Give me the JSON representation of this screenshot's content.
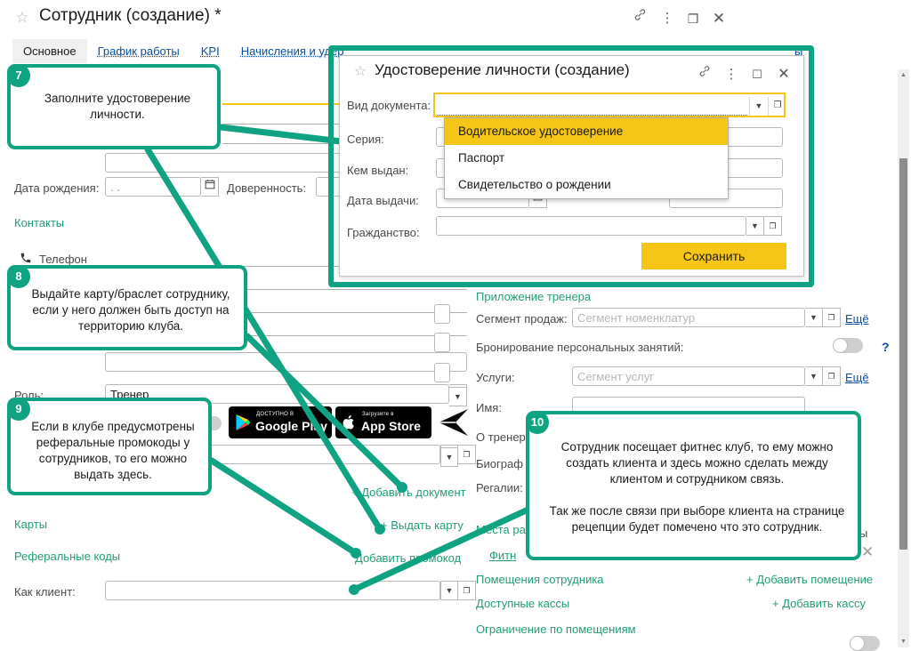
{
  "window": {
    "title": "Сотрудник (создание) *",
    "star_icon": "☆",
    "buttons": {
      "link": "link-icon",
      "menu": "menu-icon",
      "restore": "restore-icon",
      "close": "close-icon"
    }
  },
  "tabs": [
    {
      "label": "Основное",
      "active": true
    },
    {
      "label": "График работы",
      "active": false
    },
    {
      "label": "KPI",
      "active": false
    },
    {
      "label": "Начисления и удер",
      "active": false
    },
    {
      "label": "ы",
      "active": false
    }
  ],
  "form_left": {
    "birth_date": {
      "label": "Дата рождения:",
      "value": "  .    ."
    },
    "power_of_attorney": {
      "label": "Доверенность:"
    },
    "contacts_header": "Контакты",
    "phone": {
      "label": "Телефон",
      "icon": "phone-icon"
    },
    "role": {
      "label": "Роль:",
      "value": "Тренер"
    },
    "cards_header": "Карты",
    "referral_header": "Реферальные коды",
    "as_client": {
      "label": "Как клиент:",
      "value": ""
    },
    "badges": {
      "google_play": {
        "small": "ДОСТУПНО В",
        "big": "Google Play"
      },
      "app_store": {
        "small": "Загрузите в",
        "big": "App Store"
      },
      "telegram": "telegram-icon"
    }
  },
  "form_mid_links": {
    "add_document": "+ Добавить документ",
    "issue_card": "+ Выдать карту",
    "add_promocode": "Добавить промокод"
  },
  "form_right": {
    "trainer_app_header": "Приложение тренера",
    "sales_segment": {
      "label": "Сегмент продаж:",
      "placeholder": "Сегмент номенклатур",
      "more": "Ещё"
    },
    "personal_booking": {
      "label": "Бронирование персональных занятий:",
      "help": "?"
    },
    "services": {
      "label": "Услуги:",
      "placeholder": "Сегмент услуг",
      "more": "Ещё"
    },
    "name": {
      "label": "Имя:"
    },
    "about_trainer": {
      "label": "О тренер"
    },
    "biography": {
      "label": "Биограф"
    },
    "regalia": {
      "label": "Регалии:"
    },
    "workplaces": {
      "label": "Места ра"
    },
    "fitness_link": "Фитн",
    "truncated_link": "ра:",
    "truncated_text": "ты",
    "rooms": {
      "label": "Помещения сотрудника",
      "action": "+ Добавить помещение"
    },
    "cashboxes": {
      "label": "Доступные кассы",
      "action": "+ Добавить кассу"
    },
    "room_restriction": {
      "label": "Ограничение по помещениям"
    }
  },
  "modal": {
    "star_icon": "☆",
    "title": "Удостоверение личности (создание)",
    "buttons": {
      "link": "link-icon",
      "menu": "menu-icon",
      "restore": "restore-icon",
      "close": "close-icon"
    },
    "fields": {
      "doc_type": {
        "label": "Вид документа:",
        "value": ""
      },
      "series": {
        "label": "Серия:"
      },
      "issued_by": {
        "label": "Кем выдан:"
      },
      "issue_date": {
        "label": "Дата выдачи:"
      },
      "citizenship": {
        "label": "Гражданство:"
      }
    },
    "dropdown_options": [
      {
        "label": "Водительское удостоверение",
        "selected": true
      },
      {
        "label": "Паспорт",
        "selected": false
      },
      {
        "label": "Свидетельство о рождении",
        "selected": false
      }
    ],
    "save_button": "Сохранить"
  },
  "callouts": [
    {
      "number": "7",
      "text": "Заполните удостоверение личности."
    },
    {
      "number": "8",
      "text": "Выдайте карту/браслет сотруднику, если у него должен быть доступ на территорию клуба."
    },
    {
      "number": "9",
      "text": "Если в клубе предусмотрены реферальные промокоды у сотрудников, то его можно выдать здесь."
    },
    {
      "number": "10",
      "text": "Сотрудник посещает фитнес клуб, то ему можно создать клиента и здесь можно сделать между клиентом и сотрудником связь.\n\nТак же после связи при выборе клиента на странице рецепции будет помечено что это сотрудник."
    }
  ],
  "colors": {
    "accent_teal": "#10a383",
    "accent_yellow": "#f5c518",
    "link_blue": "#0a4fa0",
    "label_green": "#1f9e76"
  }
}
